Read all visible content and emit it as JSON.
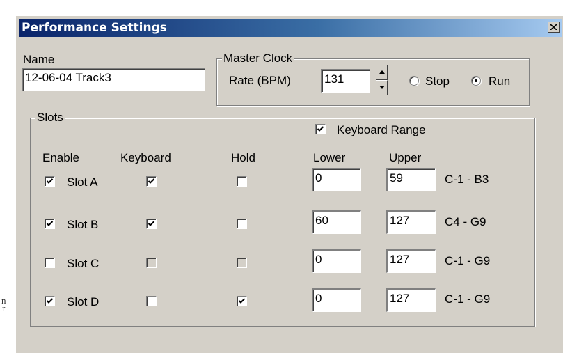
{
  "background_text": [
    "n",
    "r"
  ],
  "window": {
    "title": "Performance Settings",
    "close_icon": "close-icon"
  },
  "name_field": {
    "label": "Name",
    "value": "12-06-04 Track3"
  },
  "master_clock": {
    "group_title": "Master Clock",
    "rate_label": "Rate (BPM)",
    "rate_value": "131",
    "stop_label": "Stop",
    "run_label": "Run",
    "selected": "Run"
  },
  "slots": {
    "group_title": "Slots",
    "keyboard_range_label": "Keyboard Range",
    "keyboard_range_checked": true,
    "headers": {
      "enable": "Enable",
      "keyboard": "Keyboard",
      "hold": "Hold",
      "lower": "Lower",
      "upper": "Upper"
    },
    "rows": [
      {
        "label": "Slot A",
        "enabled": true,
        "keyboard": true,
        "keyboard_disabled": false,
        "hold": false,
        "hold_disabled": false,
        "lower": "0",
        "upper": "59",
        "range": "C-1 - B3"
      },
      {
        "label": "Slot B",
        "enabled": true,
        "keyboard": true,
        "keyboard_disabled": false,
        "hold": false,
        "hold_disabled": false,
        "lower": "60",
        "upper": "127",
        "range": "C4 - G9"
      },
      {
        "label": "Slot C",
        "enabled": false,
        "keyboard": false,
        "keyboard_disabled": true,
        "hold": false,
        "hold_disabled": true,
        "lower": "0",
        "upper": "127",
        "range": "C-1 - G9"
      },
      {
        "label": "Slot D",
        "enabled": true,
        "keyboard": false,
        "keyboard_disabled": false,
        "hold": true,
        "hold_disabled": false,
        "lower": "0",
        "upper": "127",
        "range": "C-1 - G9"
      }
    ]
  }
}
